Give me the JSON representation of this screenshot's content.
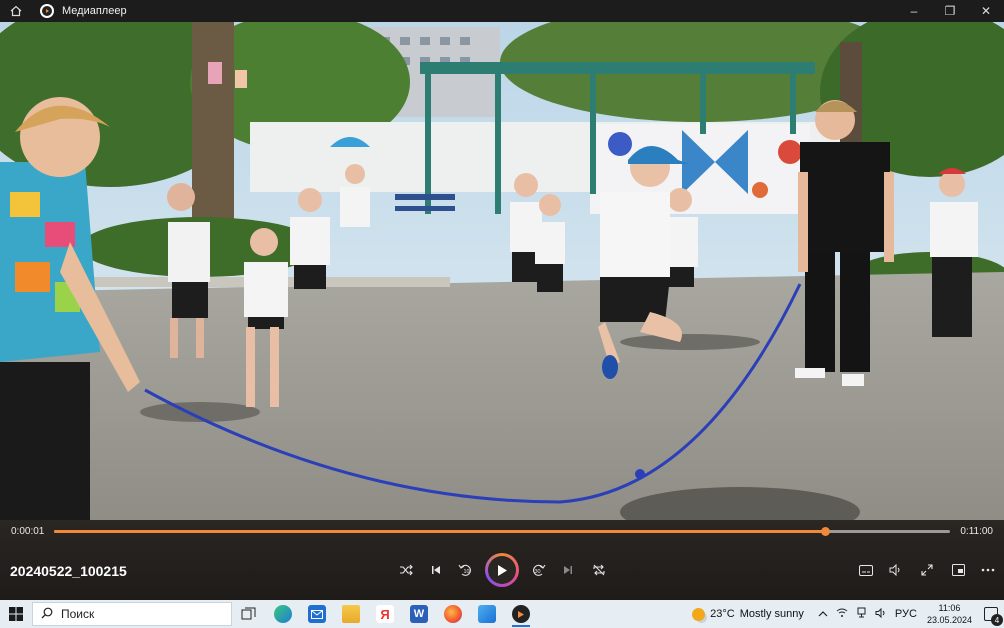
{
  "window": {
    "title": "Медиаплеер",
    "controls": {
      "minimize": "–",
      "maximize": "❐",
      "close": "✕"
    }
  },
  "player": {
    "current_time": "0:00:01",
    "duration": "0:11:00",
    "progress_fraction": 0.86,
    "file_name": "20240522_100215",
    "accent_color": "#f08a3a"
  },
  "taskbar": {
    "search_placeholder": "Поиск",
    "weather_temp": "23°C",
    "weather_text": "Mostly sunny",
    "language": "РУС",
    "time": "11:06",
    "date": "23.05.2024",
    "notifications_count": "4",
    "pinned_apps": [
      "task-view",
      "edge",
      "mail",
      "file-explorer",
      "yandex-browser",
      "word",
      "firefox",
      "photos",
      "media-player"
    ]
  }
}
